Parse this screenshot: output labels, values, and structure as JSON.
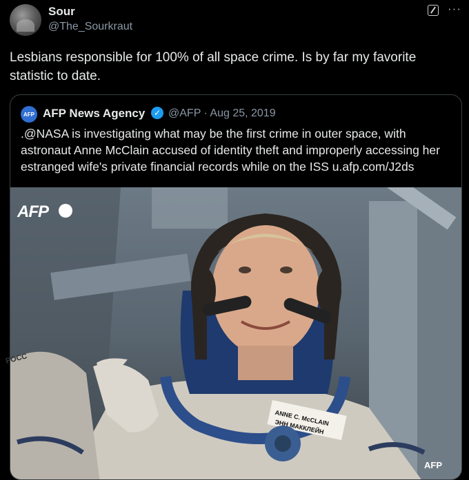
{
  "author": {
    "display_name": "Sour",
    "handle": "@The_Sourkraut"
  },
  "tweet": {
    "text": "Lesbians responsible for 100% of all space crime. Is by far my favorite statistic to date."
  },
  "quoted_tweet": {
    "avatar_text": "AFP",
    "display_name": "AFP News Agency",
    "meta": "@AFP · Aug 25, 2019",
    "text": ".@NASA is investigating what may be the first crime in outer space, with astronaut Anne McClain accused of identity theft and improperly accessing her estranged wife's private financial records while on the ISS u.afp.com/J2ds"
  },
  "photo": {
    "watermark": "AFP",
    "credit": "AFP",
    "name_patch_line1": "ANNE C. McCLAIN",
    "name_patch_line2": "ЭНН МАККЛЕЙН",
    "sleeve_text": "РОСС"
  },
  "colors": {
    "background": "#000000",
    "text": "#e7e9ea",
    "secondary_text": "#8b98a5",
    "verified": "#1d9bf0",
    "afp_avatar": "#2f6fd1"
  }
}
